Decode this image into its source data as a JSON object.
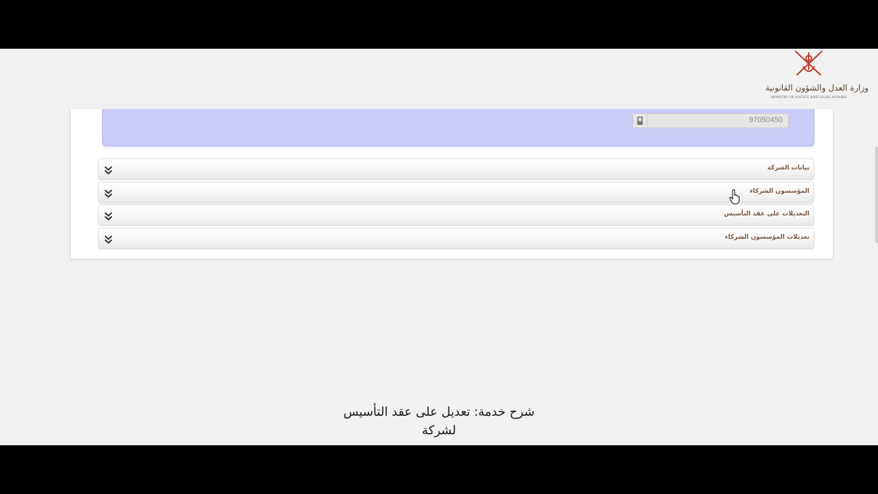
{
  "logo": {
    "arabic": "وزارة العدل والشؤون القانونية",
    "english": "MINISTRY OF JUSTICE AND LEGAL AFFAIRS"
  },
  "contact": {
    "mobile_value": "97050450"
  },
  "accordion": [
    {
      "label": "بيانات الشركة"
    },
    {
      "label": "المؤسسون الشركاء"
    },
    {
      "label": "التعديلات على عقد التأسيس"
    },
    {
      "label": "تعديلات المؤسسون الشركاء"
    }
  ],
  "caption": {
    "line1": "شرح خدمة: تعديل على عقد التأسيس",
    "line2": "لشركة"
  },
  "colors": {
    "panel_blue": "#ccccf8",
    "label_brown": "#7a5a44",
    "logo_red": "#c0392b"
  }
}
